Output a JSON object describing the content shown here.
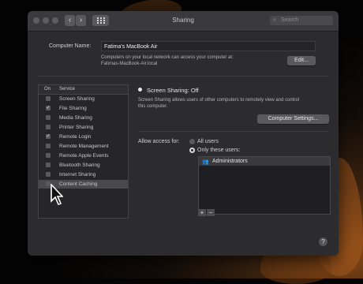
{
  "window": {
    "title": "Sharing",
    "search": {
      "placeholder": "Search"
    }
  },
  "computer_name": {
    "label": "Computer Name:",
    "value": "Fatima's MacBook Air",
    "info_line1": "Computers on your local network can access your computer at:",
    "info_line2": "Fatimas-MacBook-Air.local",
    "edit_label": "Edit..."
  },
  "services": {
    "col_on": "On",
    "col_service": "Service",
    "items": [
      {
        "label": "Screen Sharing",
        "checked": false,
        "selected": false
      },
      {
        "label": "File Sharing",
        "checked": true,
        "selected": false
      },
      {
        "label": "Media Sharing",
        "checked": false,
        "selected": false
      },
      {
        "label": "Printer Sharing",
        "checked": false,
        "selected": false
      },
      {
        "label": "Remote Login",
        "checked": true,
        "selected": false
      },
      {
        "label": "Remote Management",
        "checked": false,
        "selected": false
      },
      {
        "label": "Remote Apple Events",
        "checked": false,
        "selected": false
      },
      {
        "label": "Bluetooth Sharing",
        "checked": false,
        "selected": false
      },
      {
        "label": "Internet Sharing",
        "checked": false,
        "selected": false
      },
      {
        "label": "Content Caching",
        "checked": false,
        "selected": true
      }
    ]
  },
  "detail": {
    "status": "Screen Sharing: Off",
    "description_line1": "Screen Sharing allows users of other computers to remotely view and control",
    "description_line2": "this computer.",
    "computer_settings_label": "Computer Settings...",
    "allow_access_label": "Allow access for:",
    "all_users_label": "All users",
    "only_these_users_label": "Only these users:",
    "users": [
      "Administrators"
    ],
    "add_label": "+",
    "remove_label": "−"
  },
  "help_label": "?"
}
